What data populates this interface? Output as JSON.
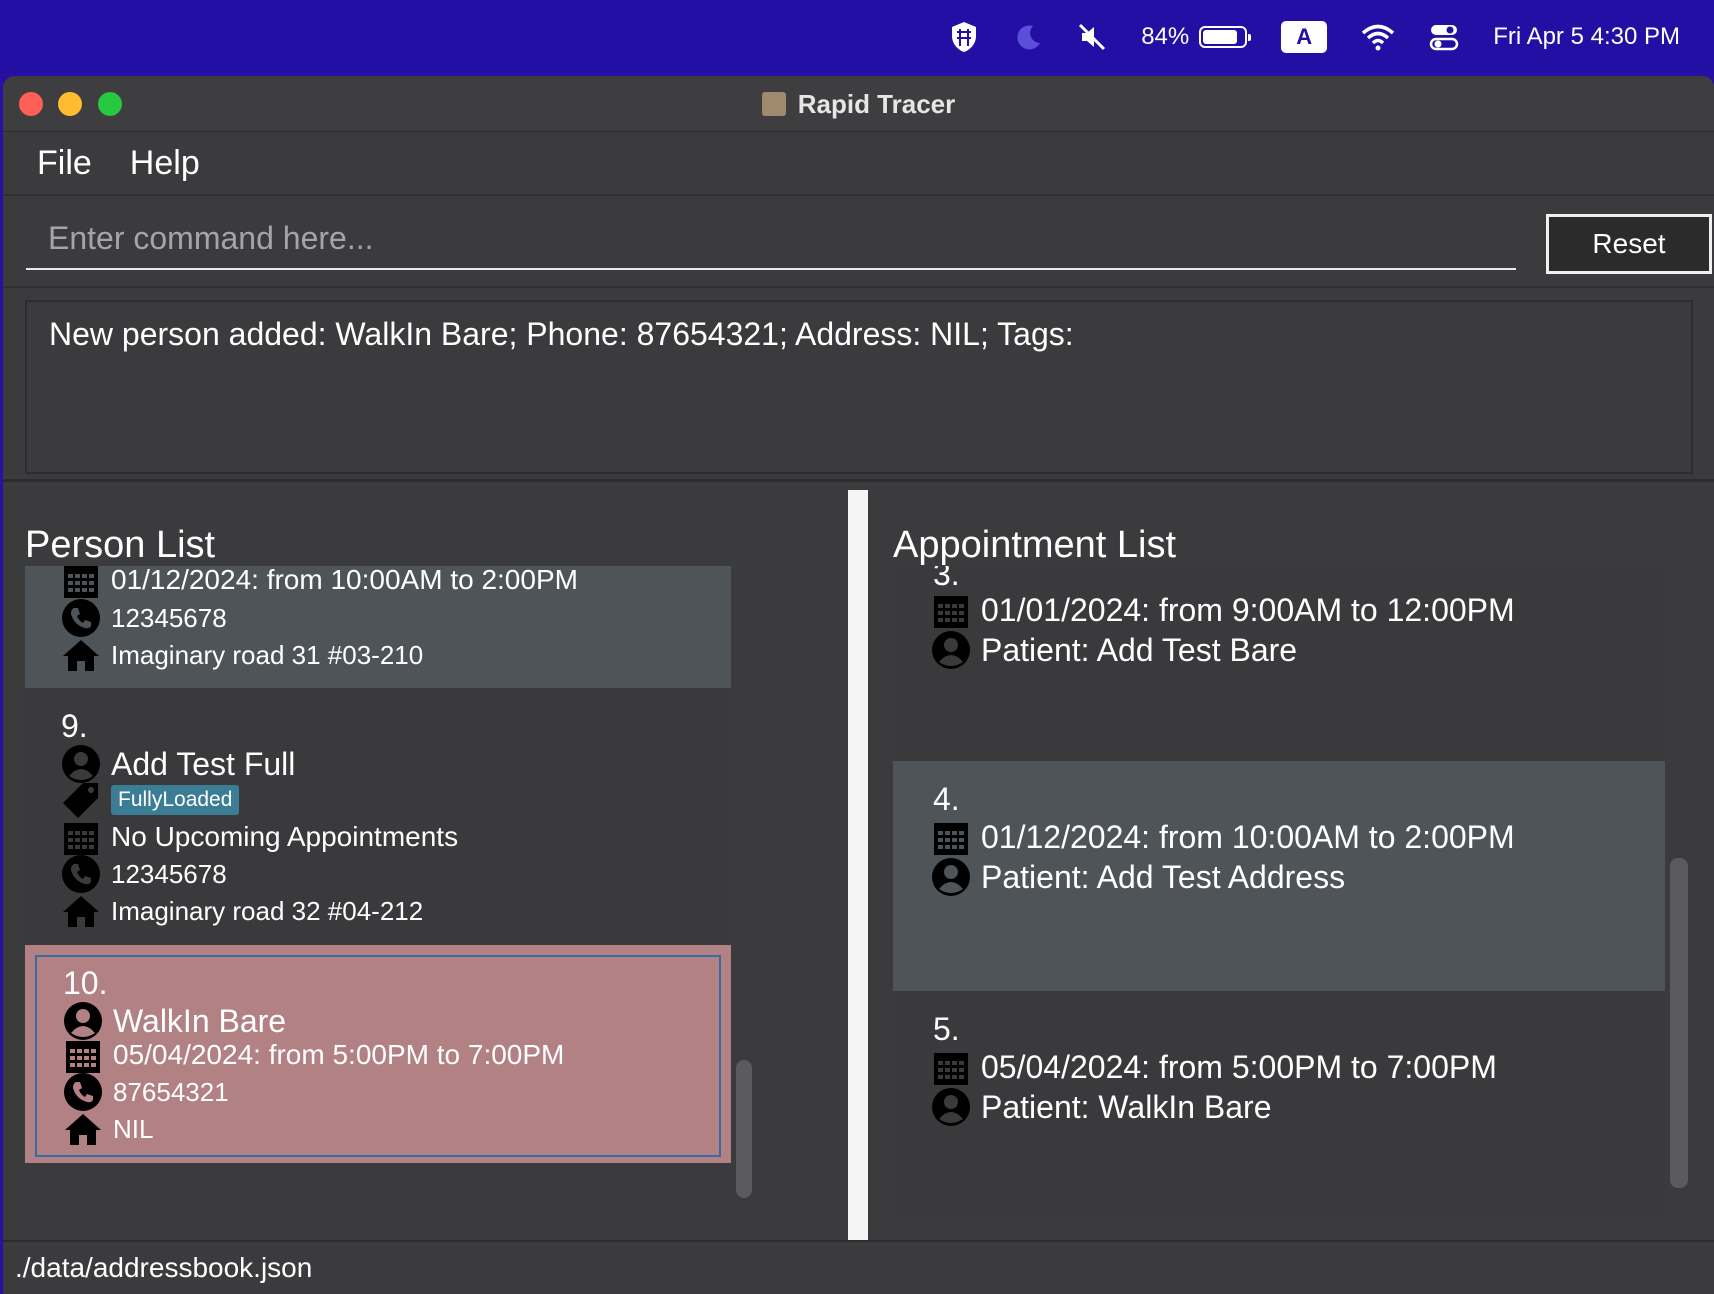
{
  "menubar": {
    "battery_percent": "84%",
    "battery_level": 0.84,
    "keyboard_input": "A",
    "datetime": "Fri Apr 5  4:30 PM"
  },
  "window": {
    "title": "Rapid Tracer"
  },
  "menu": {
    "file_label": "File",
    "help_label": "Help"
  },
  "command": {
    "placeholder": "Enter command here...",
    "value": "",
    "reset_label": "Reset"
  },
  "result": {
    "message": "New person added: WalkIn Bare; Phone: 87654321; Address: NIL; Tags:"
  },
  "person_list": {
    "title": "Person List",
    "partial_card": {
      "appointment": "01/12/2024: from 10:00AM to 2:00PM",
      "phone": "12345678",
      "address": "Imaginary road 31 #03-210"
    },
    "cards": [
      {
        "number": "9.",
        "name": "Add Test Full",
        "tag": "FullyLoaded",
        "appointment": "No Upcoming Appointments",
        "phone": "12345678",
        "address": "Imaginary road 32 #04-212"
      },
      {
        "number": "10.",
        "name": "WalkIn Bare",
        "appointment": "05/04/2024: from 5:00PM to 7:00PM",
        "phone": "87654321",
        "address": "NIL"
      }
    ]
  },
  "appointment_list": {
    "title": "Appointment List",
    "cards": [
      {
        "number": "3.",
        "time": "01/01/2024: from 9:00AM to 12:00PM",
        "patient": "Patient: Add Test Bare"
      },
      {
        "number": "4.",
        "time": "01/12/2024: from 10:00AM to 2:00PM",
        "patient": "Patient: Add Test Address"
      },
      {
        "number": "5.",
        "time": "05/04/2024: from 5:00PM to 7:00PM",
        "patient": "Patient: WalkIn Bare"
      }
    ]
  },
  "status": {
    "file_path": "./data/addressbook.json"
  },
  "colors": {
    "menubar_bg": "#230fa3",
    "window_bg": "#3b3b3d",
    "selected_card": "#b28184",
    "alt_card": "#4f5458",
    "tag_bg": "#3b7d94"
  }
}
